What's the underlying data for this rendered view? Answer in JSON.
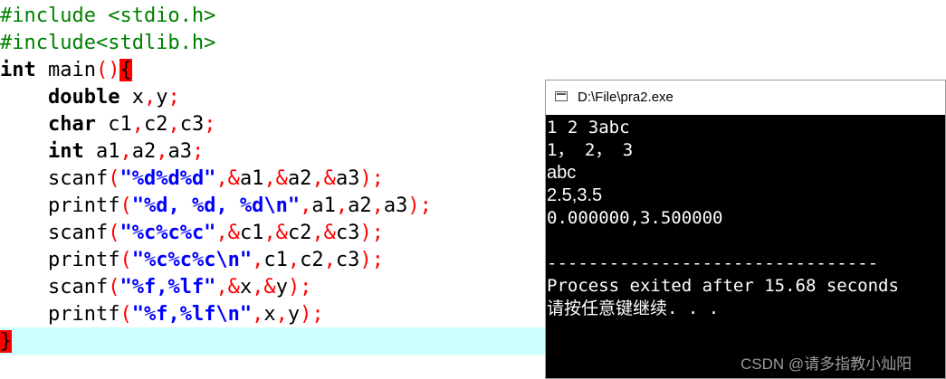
{
  "editor": {
    "lines": [
      {
        "p1": "#include <stdio.h>"
      },
      {
        "p1": "#include<stdlib.h>"
      },
      {
        "kw": "int",
        "t1": " main",
        "s1": "()",
        "b": "{"
      },
      {
        "ind": "    ",
        "kw": "double",
        "t1": " x",
        "s1": ",",
        "t2": "y",
        "s2": ";"
      },
      {
        "ind": "    ",
        "kw": "char",
        "t1": " c1",
        "s1": ",",
        "t2": "c2",
        "s2": ",",
        "t3": "c3",
        "s3": ";"
      },
      {
        "ind": "    ",
        "kw": "int",
        "t1": " a1",
        "s1": ",",
        "t2": "a2",
        "s2": ",",
        "t3": "a3",
        "s3": ";"
      },
      {
        "ind": "    ",
        "t1": "scanf",
        "s1": "(",
        "str": "\"%d%d%d\"",
        "s2": ",&",
        "t2": "a1",
        "s3": ",&",
        "t3": "a2",
        "s4": ",&",
        "t4": "a3",
        "s5": ");"
      },
      {
        "ind": "    ",
        "t1": "printf",
        "s1": "(",
        "str": "\"%d, %d, %d\\n\"",
        "s2": ",",
        "t2": "a1",
        "s3": ",",
        "t3": "a2",
        "s4": ",",
        "t4": "a3",
        "s5": ");"
      },
      {
        "ind": "    ",
        "t1": "scanf",
        "s1": "(",
        "str": "\"%c%c%c\"",
        "s2": ",&",
        "t2": "c1",
        "s3": ",&",
        "t3": "c2",
        "s4": ",&",
        "t4": "c3",
        "s5": ");"
      },
      {
        "ind": "    ",
        "t1": "printf",
        "s1": "(",
        "str": "\"%c%c%c\\n\"",
        "s2": ",",
        "t2": "c1",
        "s3": ",",
        "t3": "c2",
        "s4": ",",
        "t4": "c3",
        "s5": ");"
      },
      {
        "ind": "    ",
        "t1": "scanf",
        "s1": "(",
        "str": "\"%f,%lf\"",
        "s2": ",&",
        "t2": "x",
        "s3": ",&",
        "t3": "y",
        "s4": ");"
      },
      {
        "ind": "    ",
        "t1": "printf",
        "s1": "(",
        "str": "\"%f,%lf\\n\"",
        "s2": ",",
        "t2": "x",
        "s3": ",",
        "t3": "y",
        "s4": ");"
      },
      {
        "b": "}"
      }
    ]
  },
  "console": {
    "title": "D:\\File\\pra2.exe",
    "lines": [
      "1 2 3abc",
      "1， 2， 3",
      "abc",
      "2.5,3.5",
      "0.000000,3.500000",
      "",
      "--------------------------------",
      "Process exited after 15.68 seconds",
      "请按任意键继续. . ."
    ]
  },
  "watermark": "CSDN @请多指教小灿阳"
}
